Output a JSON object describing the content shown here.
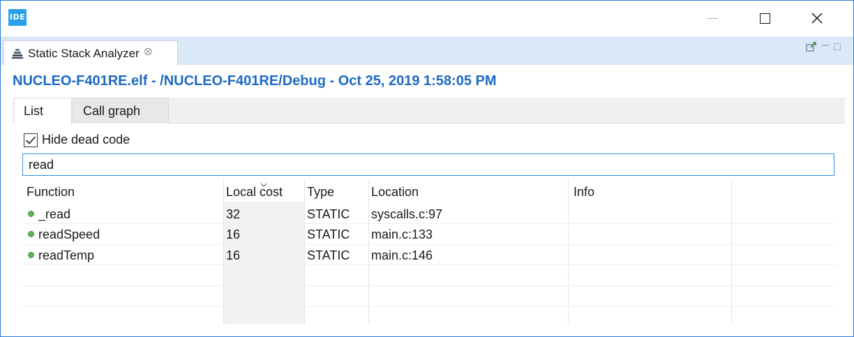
{
  "app": {
    "icon_text": "IDE"
  },
  "view_tab": {
    "label": "Static Stack Analyzer",
    "close_glyph": "⨂"
  },
  "heading": "NUCLEO-F401RE.elf - /NUCLEO-F401RE/Debug - Oct 25, 2019 1:58:05 PM",
  "tabs": [
    {
      "label": "List",
      "active": true
    },
    {
      "label": "Call graph",
      "active": false
    }
  ],
  "hide_dead_code": {
    "label": "Hide dead code",
    "checked": true
  },
  "filter": {
    "value": "read"
  },
  "table": {
    "columns": [
      "Function",
      "Local cost",
      "Type",
      "Location",
      "Info"
    ],
    "rows": [
      {
        "function": "_read",
        "local_cost": "32",
        "type": "STATIC",
        "location": "syscalls.c:97",
        "info": ""
      },
      {
        "function": "readSpeed",
        "local_cost": "16",
        "type": "STATIC",
        "location": "main.c:133",
        "info": ""
      },
      {
        "function": "readTemp",
        "local_cost": "16",
        "type": "STATIC",
        "location": "main.c:146",
        "info": ""
      }
    ]
  },
  "colors": {
    "accent": "#1c6ac4",
    "tab_strip": "#dbe8f7",
    "window_border": "#2b79d3",
    "dot_green": "#5fb55a"
  }
}
